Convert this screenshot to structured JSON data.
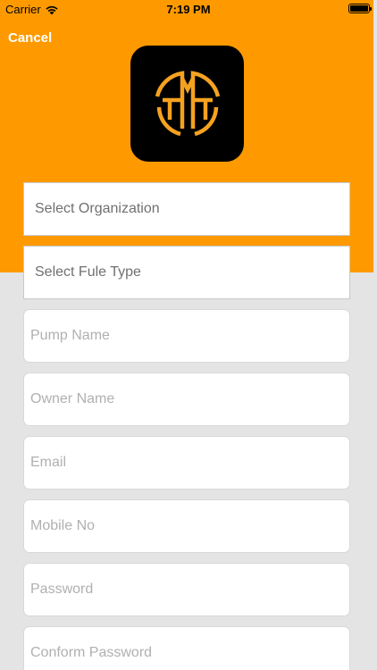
{
  "status_bar": {
    "carrier": "Carrier",
    "time": "7:19 PM",
    "wifi_icon": "wifi-icon",
    "battery_icon": "battery-icon"
  },
  "header": {
    "cancel_label": "Cancel",
    "background_color": "#fe9a00",
    "logo_icon": "app-logo-icon"
  },
  "form": {
    "organization_placeholder": "Select Organization",
    "fuel_type_placeholder": "Select Fule Type",
    "pump_name_placeholder": "Pump Name",
    "owner_name_placeholder": "Owner Name",
    "email_placeholder": "Email",
    "mobile_placeholder": "Mobile No",
    "password_placeholder": "Password",
    "confirm_password_placeholder": "Conform Password"
  },
  "colors": {
    "accent": "#fe9a00",
    "background": "#e4e4e4"
  }
}
